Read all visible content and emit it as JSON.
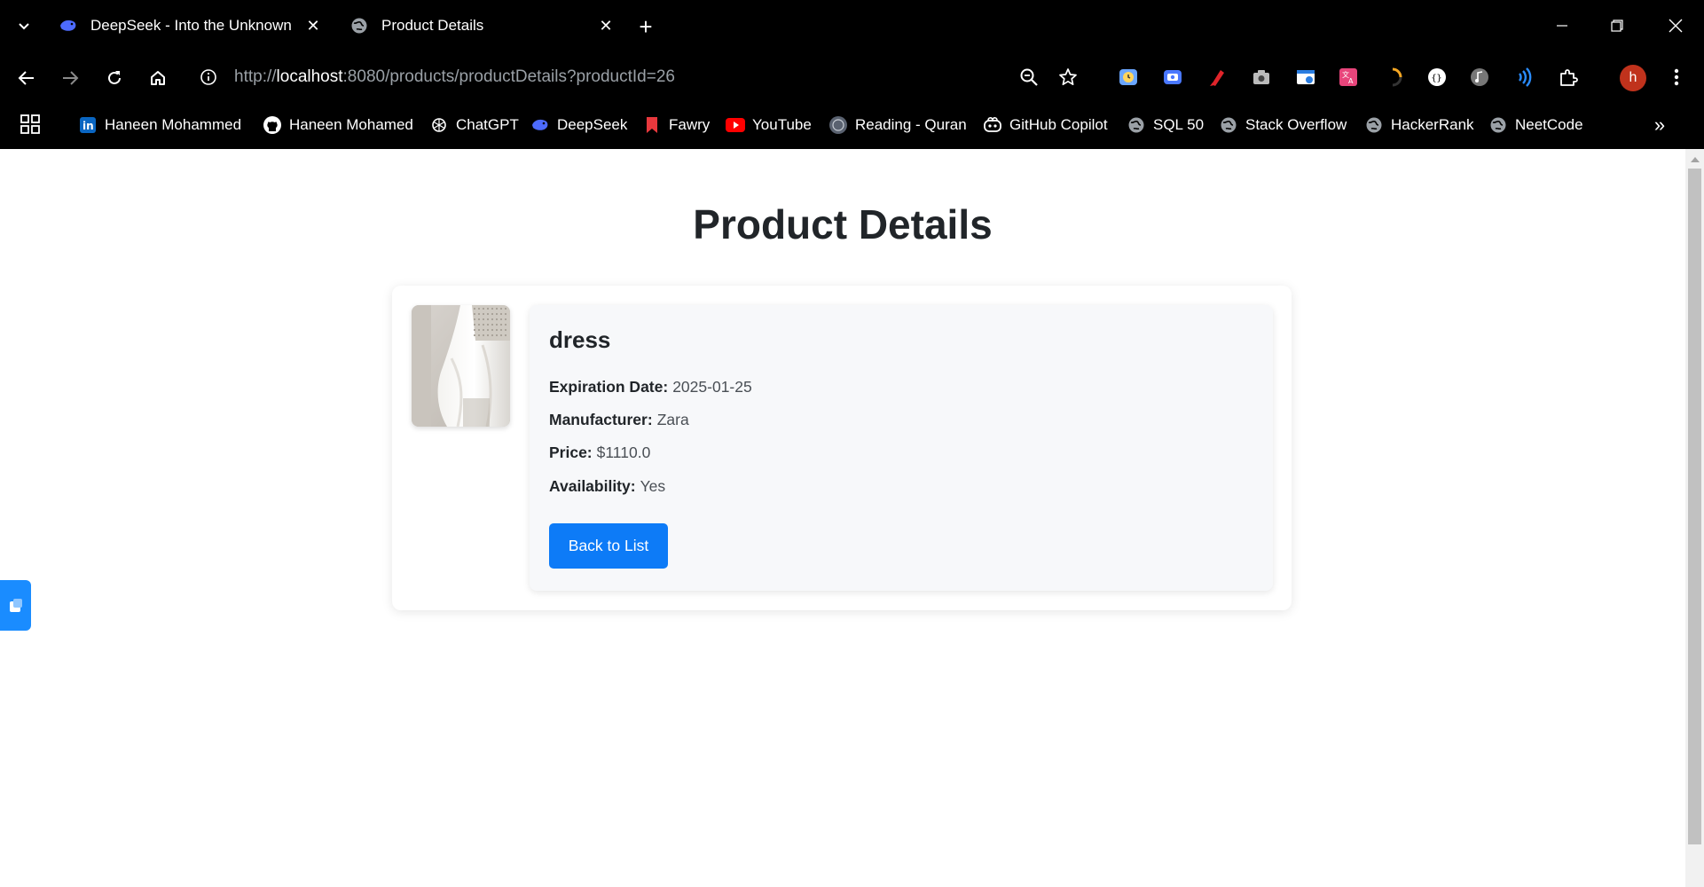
{
  "browser": {
    "tabs": [
      {
        "title": "DeepSeek - Into the Unknown",
        "icon": "deepseek-whale-icon"
      },
      {
        "title": "Product Details",
        "icon": "globe-icon"
      }
    ],
    "address_bar": {
      "scheme": "http://",
      "host": "localhost",
      "path": ":8080/products/productDetails?productId=26"
    },
    "profile_initial": "h",
    "bookmarks": [
      {
        "label": "Haneen Mohammed",
        "icon": "linkedin-icon",
        "color": "#0a66c2"
      },
      {
        "label": "Haneen Mohamed",
        "icon": "github-icon",
        "color": "#ffffff"
      },
      {
        "label": "ChatGPT",
        "icon": "chatgpt-icon",
        "color": "#ffffff"
      },
      {
        "label": "DeepSeek",
        "icon": "deepseek-whale-icon",
        "color": "#4d6bfe"
      },
      {
        "label": "Fawry",
        "icon": "bookmark-icon",
        "color": "#e8383d"
      },
      {
        "label": "YouTube",
        "icon": "youtube-icon",
        "color": "#ff0000"
      },
      {
        "label": "Reading - Quran",
        "icon": "quran-icon",
        "color": "#8a8f99"
      },
      {
        "label": "GitHub Copilot",
        "icon": "copilot-icon",
        "color": "#ffffff"
      },
      {
        "label": "SQL 50",
        "icon": "globe-icon",
        "color": "#9aa0a6"
      },
      {
        "label": "Stack Overflow",
        "icon": "globe-icon",
        "color": "#9aa0a6"
      },
      {
        "label": "HackerRank",
        "icon": "globe-icon",
        "color": "#9aa0a6"
      },
      {
        "label": "NeetCode",
        "icon": "globe-icon",
        "color": "#9aa0a6"
      }
    ]
  },
  "page": {
    "heading": "Product Details",
    "product": {
      "name": "dress",
      "image": "dress-photo",
      "fields": [
        {
          "label": "Expiration Date:",
          "value": "2025-01-25"
        },
        {
          "label": "Manufacturer:",
          "value": "Zara"
        },
        {
          "label": "Price:",
          "value": "$1110.0"
        },
        {
          "label": "Availability:",
          "value": "Yes"
        }
      ]
    },
    "back_button": "Back to List"
  },
  "colors": {
    "chrome_bg": "#000000",
    "button_primary": "#0d7bf7",
    "details_bg": "#f7f8fa",
    "text_dark": "#212529"
  }
}
